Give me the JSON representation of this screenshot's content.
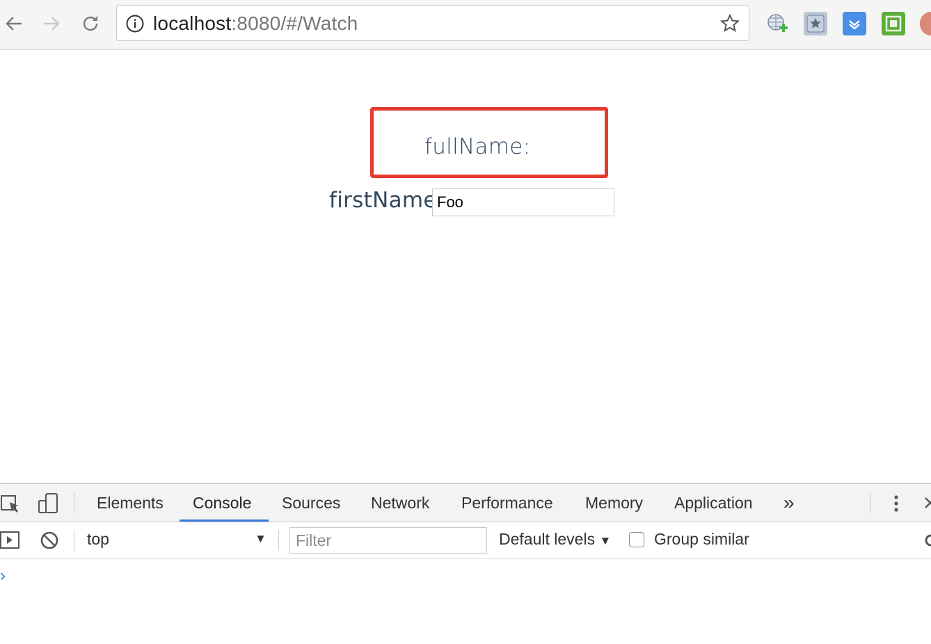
{
  "browser": {
    "url_host": "localhost",
    "url_rest": ":8080/#/Watch",
    "nav_icons": [
      "back-arrow-icon",
      "forward-arrow-icon",
      "reload-icon"
    ],
    "extension_icons": [
      "globe-plus-icon",
      "bookmark-star-icon",
      "download-icon",
      "green-square-icon",
      "profile-icon"
    ]
  },
  "page": {
    "fullname_label": "fullName:",
    "firstname_label": "firstName:",
    "firstname_value": "Foo",
    "highlight_color": "#e53a2e",
    "text_color": "#34495e"
  },
  "devtools": {
    "tabs": [
      {
        "label": "Elements"
      },
      {
        "label": "Console"
      },
      {
        "label": "Sources"
      },
      {
        "label": "Network"
      },
      {
        "label": "Performance"
      },
      {
        "label": "Memory"
      },
      {
        "label": "Application"
      }
    ],
    "active_tab": "Console",
    "more_tabs": "»",
    "console": {
      "context": "top",
      "filter_placeholder": "Filter",
      "levels_label": "Default levels",
      "group_similar_label": "Group similar",
      "group_similar_checked": false,
      "prompt": "›"
    },
    "accent_color": "#3879d9"
  }
}
